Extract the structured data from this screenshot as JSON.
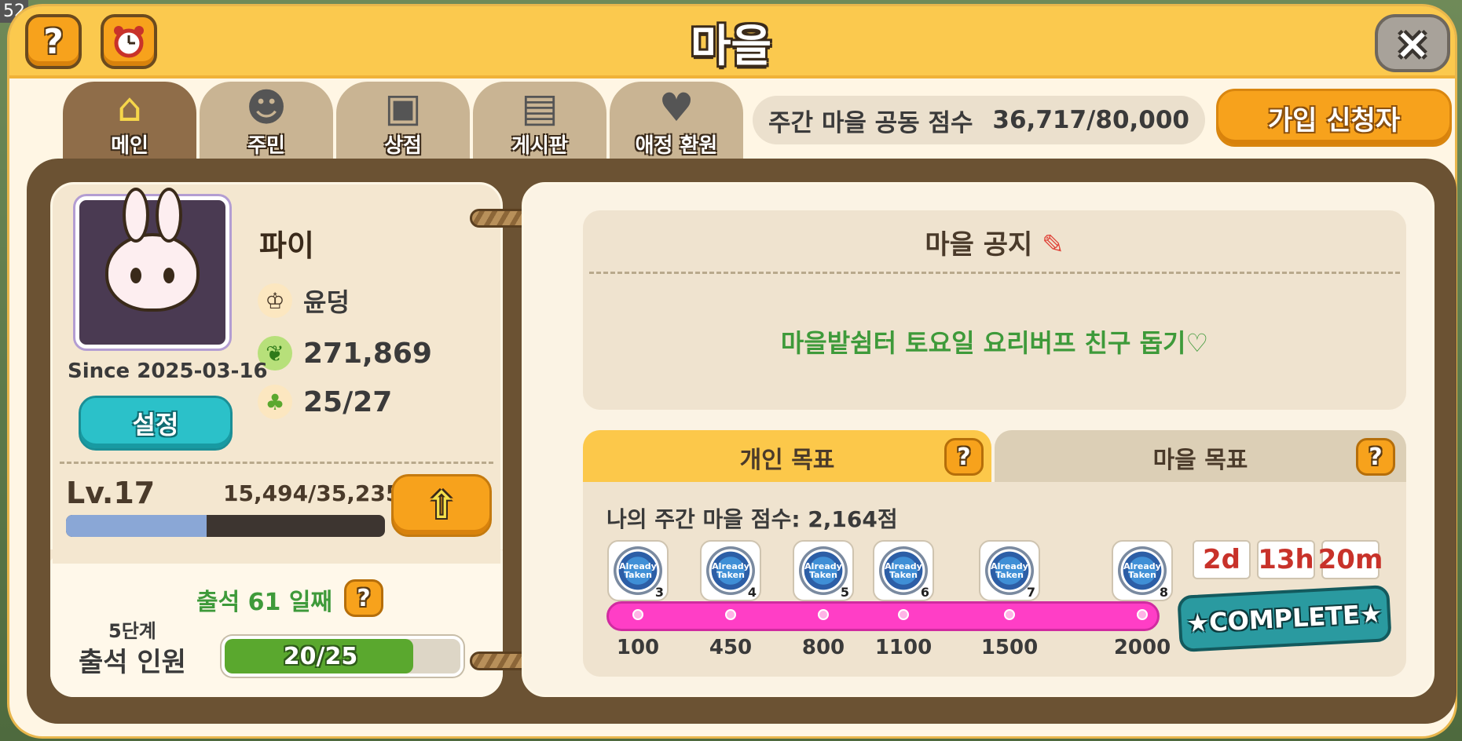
{
  "header": {
    "title": "마을",
    "help_icon": "?",
    "alarm_icon": "alarm-clock-icon",
    "close_icon": "×"
  },
  "corner_fragment": "52",
  "tabs": [
    {
      "label": "메인",
      "icon": "house-icon",
      "active": true
    },
    {
      "label": "주민",
      "icon": "resident-icon",
      "active": false
    },
    {
      "label": "상점",
      "icon": "basket-icon",
      "active": false
    },
    {
      "label": "게시판",
      "icon": "board-icon",
      "active": false
    },
    {
      "label": "애정 환원",
      "icon": "heart-icon",
      "active": false
    }
  ],
  "weekly_score": {
    "label": "주간 마을 공동 점수",
    "value": "36,717/80,000"
  },
  "join_button": "가입 신청자",
  "profile": {
    "name": "파이",
    "since": "Since 2025-03-16",
    "settings_button": "설정",
    "role": "윤덩",
    "leaves": "271,869",
    "members": "25/27",
    "level": "Lv.17",
    "xp_text": "15,494/35,235",
    "xp_progress": 0.44,
    "up_icon": "⇧"
  },
  "attendance": {
    "days_label": "출석 61 일째",
    "help": "?",
    "stage": "5단계",
    "label": "출석 인원",
    "value": "20/25",
    "progress": 0.8
  },
  "notice": {
    "title": "마을 공지",
    "pencil_icon": "✎",
    "text": "마을밭쉼터 토요일 요리버프 친구 돕기♡"
  },
  "goals": {
    "tabs": [
      {
        "label": "개인 목표",
        "help": "?"
      },
      {
        "label": "마을 목표",
        "help": "?"
      }
    ],
    "my_score": "나의 주간 마을 점수: 2,164점",
    "badge_text": "Already Taken",
    "milestones": [
      {
        "value": "100",
        "reward_count": "3"
      },
      {
        "value": "450",
        "reward_count": "4"
      },
      {
        "value": "800",
        "reward_count": "5"
      },
      {
        "value": "1100",
        "reward_count": "6"
      },
      {
        "value": "1500",
        "reward_count": "7"
      },
      {
        "value": "2000",
        "reward_count": "8"
      }
    ],
    "timer": {
      "days": "2d",
      "hours": "13h",
      "minutes": "20m"
    },
    "complete_label": "★COMPLETE★"
  },
  "colors": {
    "title_bar": "#fbc94e",
    "board": "#6b5233",
    "accent_orange": "#f7a21c",
    "teal": "#2bc1c9",
    "progress_pink": "#ff3ec6",
    "notice_green": "#3e9a3a"
  }
}
